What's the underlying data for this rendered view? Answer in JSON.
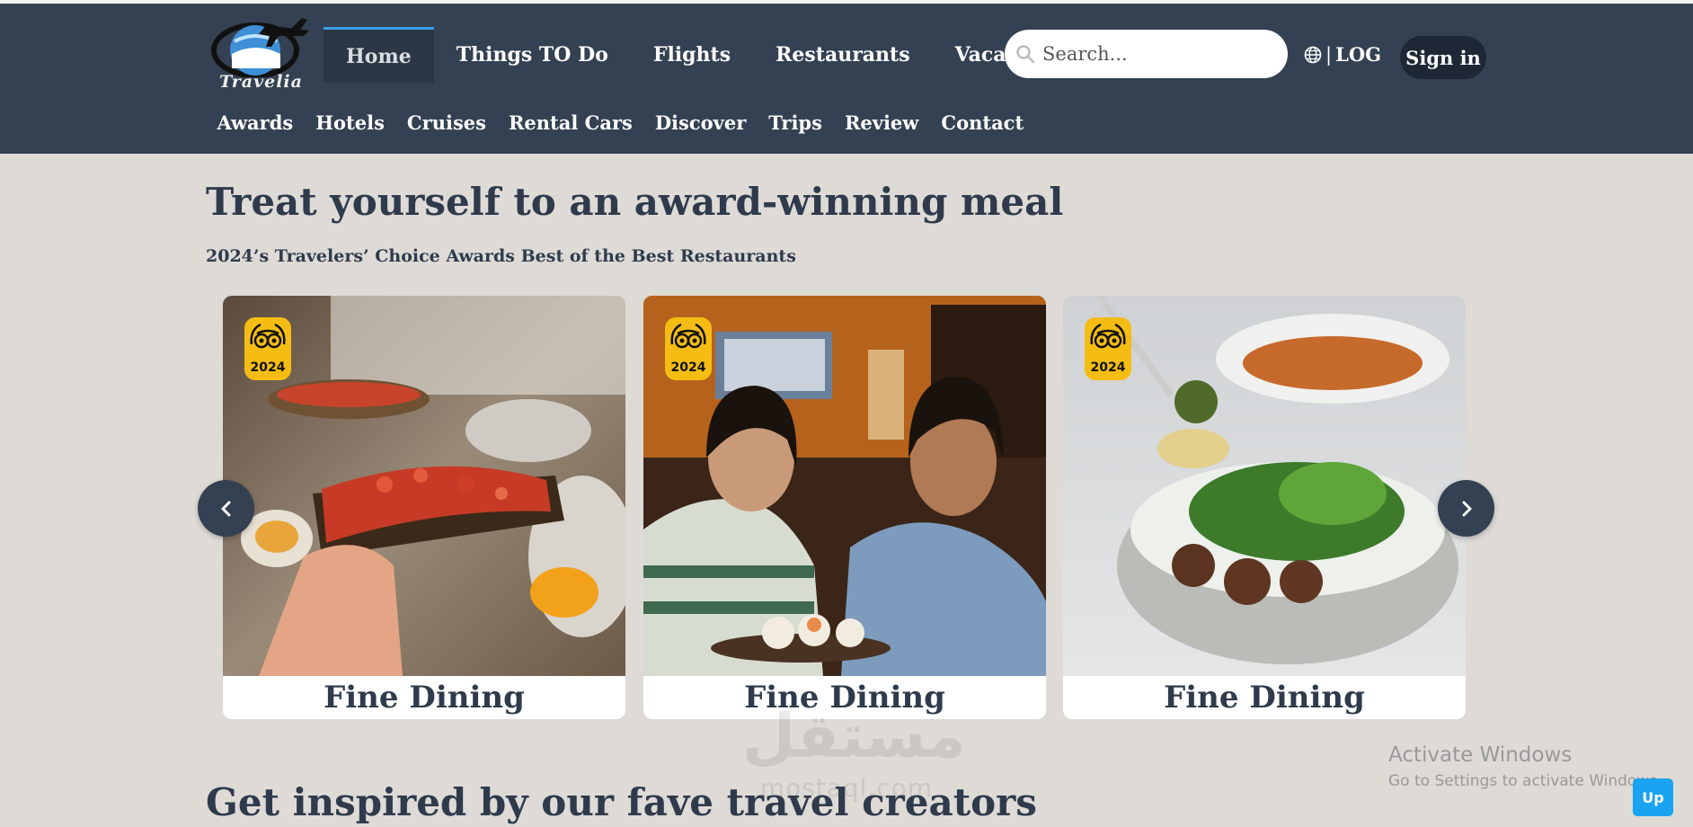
{
  "brand": {
    "logo_text": "Travelia"
  },
  "nav_primary": [
    {
      "label": "Home",
      "active": true
    },
    {
      "label": "Things TO Do"
    },
    {
      "label": "Flights"
    },
    {
      "label": "Restaurants"
    },
    {
      "label": "Vacations"
    }
  ],
  "search": {
    "placeholder": "Search..."
  },
  "language": {
    "separator": "|",
    "label": "LOG"
  },
  "signin_label": "Sign in",
  "nav_secondary": [
    "Awards",
    "Hotels",
    "Cruises",
    "Rental Cars",
    "Discover",
    "Trips",
    "Review",
    "Contact"
  ],
  "section1": {
    "title": "Treat yourself to an award-winning meal",
    "subtitle": "2024’s Travelers’ Choice Awards Best of the Best Restaurants"
  },
  "cards": [
    {
      "label": "Fine Dining",
      "badge_year": "2024",
      "image": "avocado-toast-photo"
    },
    {
      "label": "Fine Dining",
      "badge_year": "2024",
      "image": "friends-sushi-photo"
    },
    {
      "label": "Fine Dining",
      "badge_year": "2024",
      "image": "falafel-salad-photo"
    }
  ],
  "section2": {
    "title": "Get inspired by our fave travel creators"
  },
  "watermark": {
    "arabic": "مستقل",
    "latin": "mostaql.com"
  },
  "os_notice": {
    "title": "Activate Windows",
    "subtitle": "Go to Settings to activate Windows."
  },
  "up_button": "Up",
  "colors": {
    "header_bg": "#344152",
    "page_bg": "#dedad6",
    "badge": "#f5bd13",
    "accent_blue": "#3aa0e6",
    "up_button": "#1aa3f0"
  }
}
